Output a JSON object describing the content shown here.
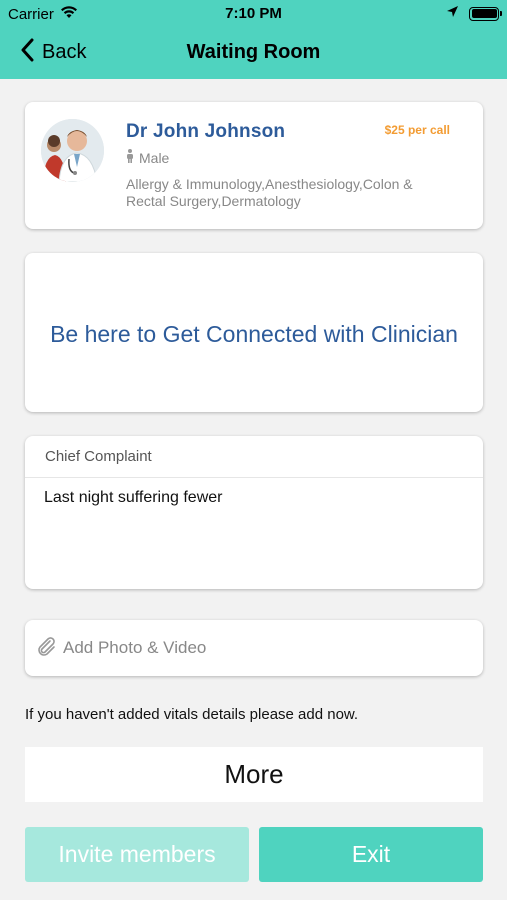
{
  "status_bar": {
    "carrier": "Carrier",
    "time": "7:10 PM",
    "icons": [
      "wifi-icon",
      "location-arrow-icon",
      "battery-icon"
    ]
  },
  "nav": {
    "back_label": "Back",
    "title": "Waiting Room",
    "back_icon": "chevron-left-icon"
  },
  "doctor": {
    "name": "Dr John  Johnson",
    "price": "$25 per call",
    "gender": "Male",
    "gender_icon": "person-icon",
    "specialties": "Allergy & Immunology,Anesthesiology,Colon & Rectal Surgery,Dermatology"
  },
  "connect": {
    "message": "Be here to Get Connected with Clinician"
  },
  "complaint": {
    "label": "Chief Complaint",
    "text": "Last night suffering fewer"
  },
  "attachment": {
    "label": "Add Photo & Video",
    "icon": "paperclip-icon"
  },
  "vitals_note": "If you haven't added vitals details please add now.",
  "more_button": "More",
  "actions": {
    "invite_label": "Invite members",
    "exit_label": "Exit"
  },
  "colors": {
    "accent": "#4fd3bf",
    "accent_disabled": "#a6e8dd",
    "name_blue": "#2d5b9a",
    "price_orange": "#f39c33"
  }
}
